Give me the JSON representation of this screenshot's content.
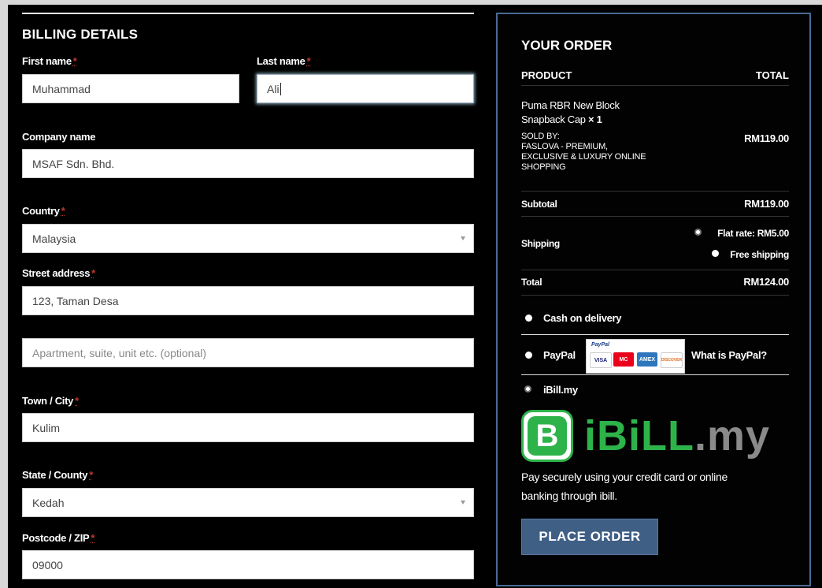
{
  "billing": {
    "title": "BILLING DETAILS",
    "first_name": {
      "label": "First name",
      "value": "Muhammad"
    },
    "last_name": {
      "label": "Last name",
      "value": "Ali"
    },
    "company": {
      "label": "Company name",
      "value": "MSAF Sdn. Bhd."
    },
    "country": {
      "label": "Country",
      "value": "Malaysia"
    },
    "street": {
      "label": "Street address",
      "value": "123, Taman Desa",
      "placeholder2": "Apartment, suite, unit etc. (optional)"
    },
    "city": {
      "label": "Town / City",
      "value": "Kulim"
    },
    "state": {
      "label": "State / County",
      "value": "Kedah"
    },
    "postcode": {
      "label": "Postcode / ZIP",
      "value": "09000"
    },
    "required_mark": "*"
  },
  "order": {
    "title": "YOUR ORDER",
    "col_product": "PRODUCT",
    "col_total": "TOTAL",
    "item": {
      "name_line1": "Puma RBR New Block",
      "name_line2": "Snapback Cap",
      "qty": "× 1",
      "sold_by_1": "SOLD BY:",
      "sold_by_2": "FASLOVA - PREMIUM,",
      "sold_by_3": "EXCLUSIVE & LUXURY ONLINE",
      "sold_by_4": "SHOPPING",
      "price": "RM119.00"
    },
    "subtotal_label": "Subtotal",
    "subtotal_value": "RM119.00",
    "shipping_label": "Shipping",
    "shipping_opt1": "Flat rate: RM5.00",
    "shipping_opt2": "Free shipping",
    "total_label": "Total",
    "total_value": "RM124.00"
  },
  "payment": {
    "cod": "Cash on delivery",
    "paypal": "PayPal",
    "paypal_logo_text": "PayPal",
    "cards": [
      "VISA",
      "MC",
      "AMEX",
      "DISCOVER"
    ],
    "what_is_paypal": "What is PayPal?",
    "ibill": "iBill.my",
    "ibill_logo_b": "B",
    "ibill_logo_word_green": "iBiLL",
    "ibill_logo_word_grey": ".my",
    "ibill_desc_1": "Pay securely using your credit card or online",
    "ibill_desc_2": "banking through ibill.",
    "place_order": "PLACE ORDER"
  },
  "colors": {
    "accent": "#3f5f85",
    "required": "#c0392b",
    "ibill_green": "#2db34a"
  }
}
